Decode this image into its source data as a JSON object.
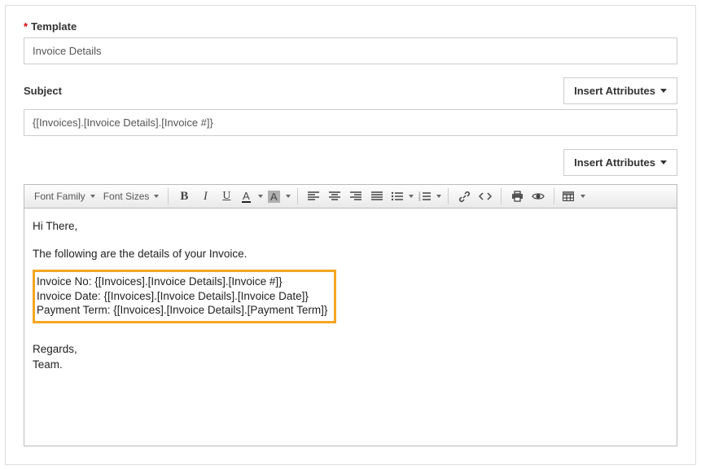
{
  "template": {
    "label": "Template",
    "value": "Invoice Details"
  },
  "subject": {
    "label": "Subject",
    "insert_btn": "Insert Attributes",
    "value": "{[Invoices].[Invoice Details].[Invoice #]}"
  },
  "body": {
    "insert_btn": "Insert Attributes"
  },
  "toolbar": {
    "font_family": "Font Family",
    "font_sizes": "Font Sizes",
    "text_color_letter": "A",
    "bg_color_letter": "A"
  },
  "editor": {
    "greeting": "Hi There,",
    "intro": "The following are the details of your Invoice.",
    "line1": "Invoice No: {[Invoices].[Invoice Details].[Invoice #]}",
    "line2": "Invoice Date: {[Invoices].[Invoice Details].[Invoice Date]}",
    "line3": "Payment Term: {[Invoices].[Invoice Details].[Payment Term]}",
    "regards": "Regards,",
    "signoff": "Team."
  }
}
